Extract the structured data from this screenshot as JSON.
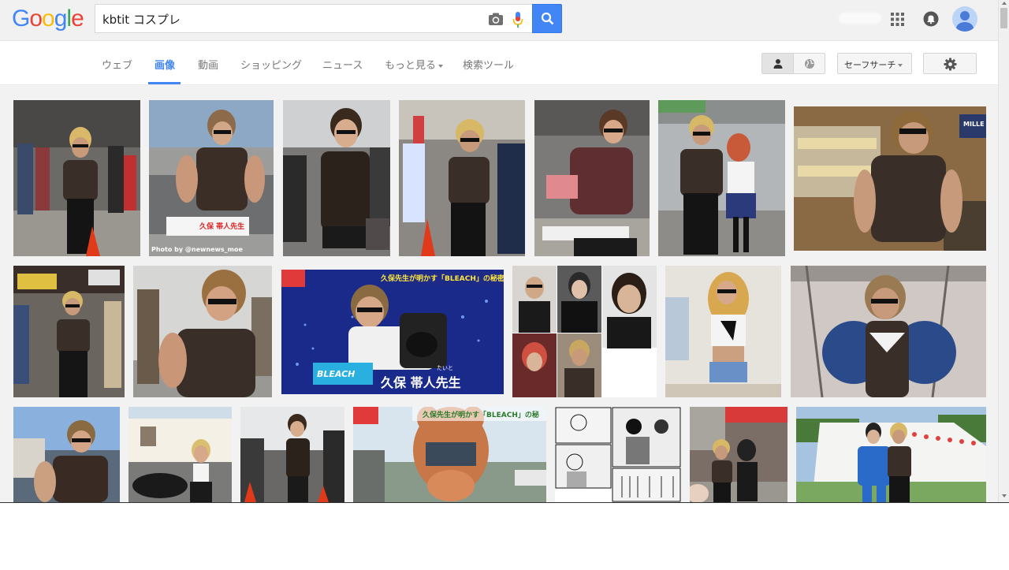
{
  "logo": {
    "letters": [
      {
        "ch": "G",
        "color": "#4285f4"
      },
      {
        "ch": "o",
        "color": "#ea4335"
      },
      {
        "ch": "o",
        "color": "#fbbc05"
      },
      {
        "ch": "g",
        "color": "#4285f4"
      },
      {
        "ch": "l",
        "color": "#34a853"
      },
      {
        "ch": "e",
        "color": "#ea4335"
      }
    ]
  },
  "search": {
    "query": "kbtit コスプレ",
    "camera_icon": "camera-icon",
    "mic_icon": "microphone-icon",
    "button_icon": "search-icon"
  },
  "header_icons": {
    "apps": "apps-grid-icon",
    "notifications": "bell-icon",
    "account": "account-avatar"
  },
  "tabs": [
    {
      "label": "ウェブ",
      "active": false
    },
    {
      "label": "画像",
      "active": true
    },
    {
      "label": "動画",
      "active": false
    },
    {
      "label": "ショッピング",
      "active": false
    },
    {
      "label": "ニュース",
      "active": false
    },
    {
      "label": "もっと見る",
      "active": false,
      "dropdown": true
    },
    {
      "label": "検索ツール",
      "active": false
    }
  ],
  "toolbar": {
    "personal_icon": "person-icon",
    "global_icon": "globe-icon",
    "safesearch_label": "セーフサーチ",
    "settings_icon": "gear-icon"
  },
  "colors": {
    "accent": "#4285f4",
    "header_bg": "#f1f1f1",
    "grid_bg": "#f2f2f2"
  },
  "image_captions": {
    "photo_credit": "Photo by @newnews_moe",
    "sign1": "久保 帯人先生",
    "tv_headline": "久保先生が明かす「BLEACH」の秘密",
    "tv_logo": "BLEACH",
    "tv_name": "久保 帯人先生",
    "tv_ruby": "たいと",
    "tv_headline2": "久保先生が明かす「BLEACH」の秘",
    "mille": "MILLE"
  }
}
